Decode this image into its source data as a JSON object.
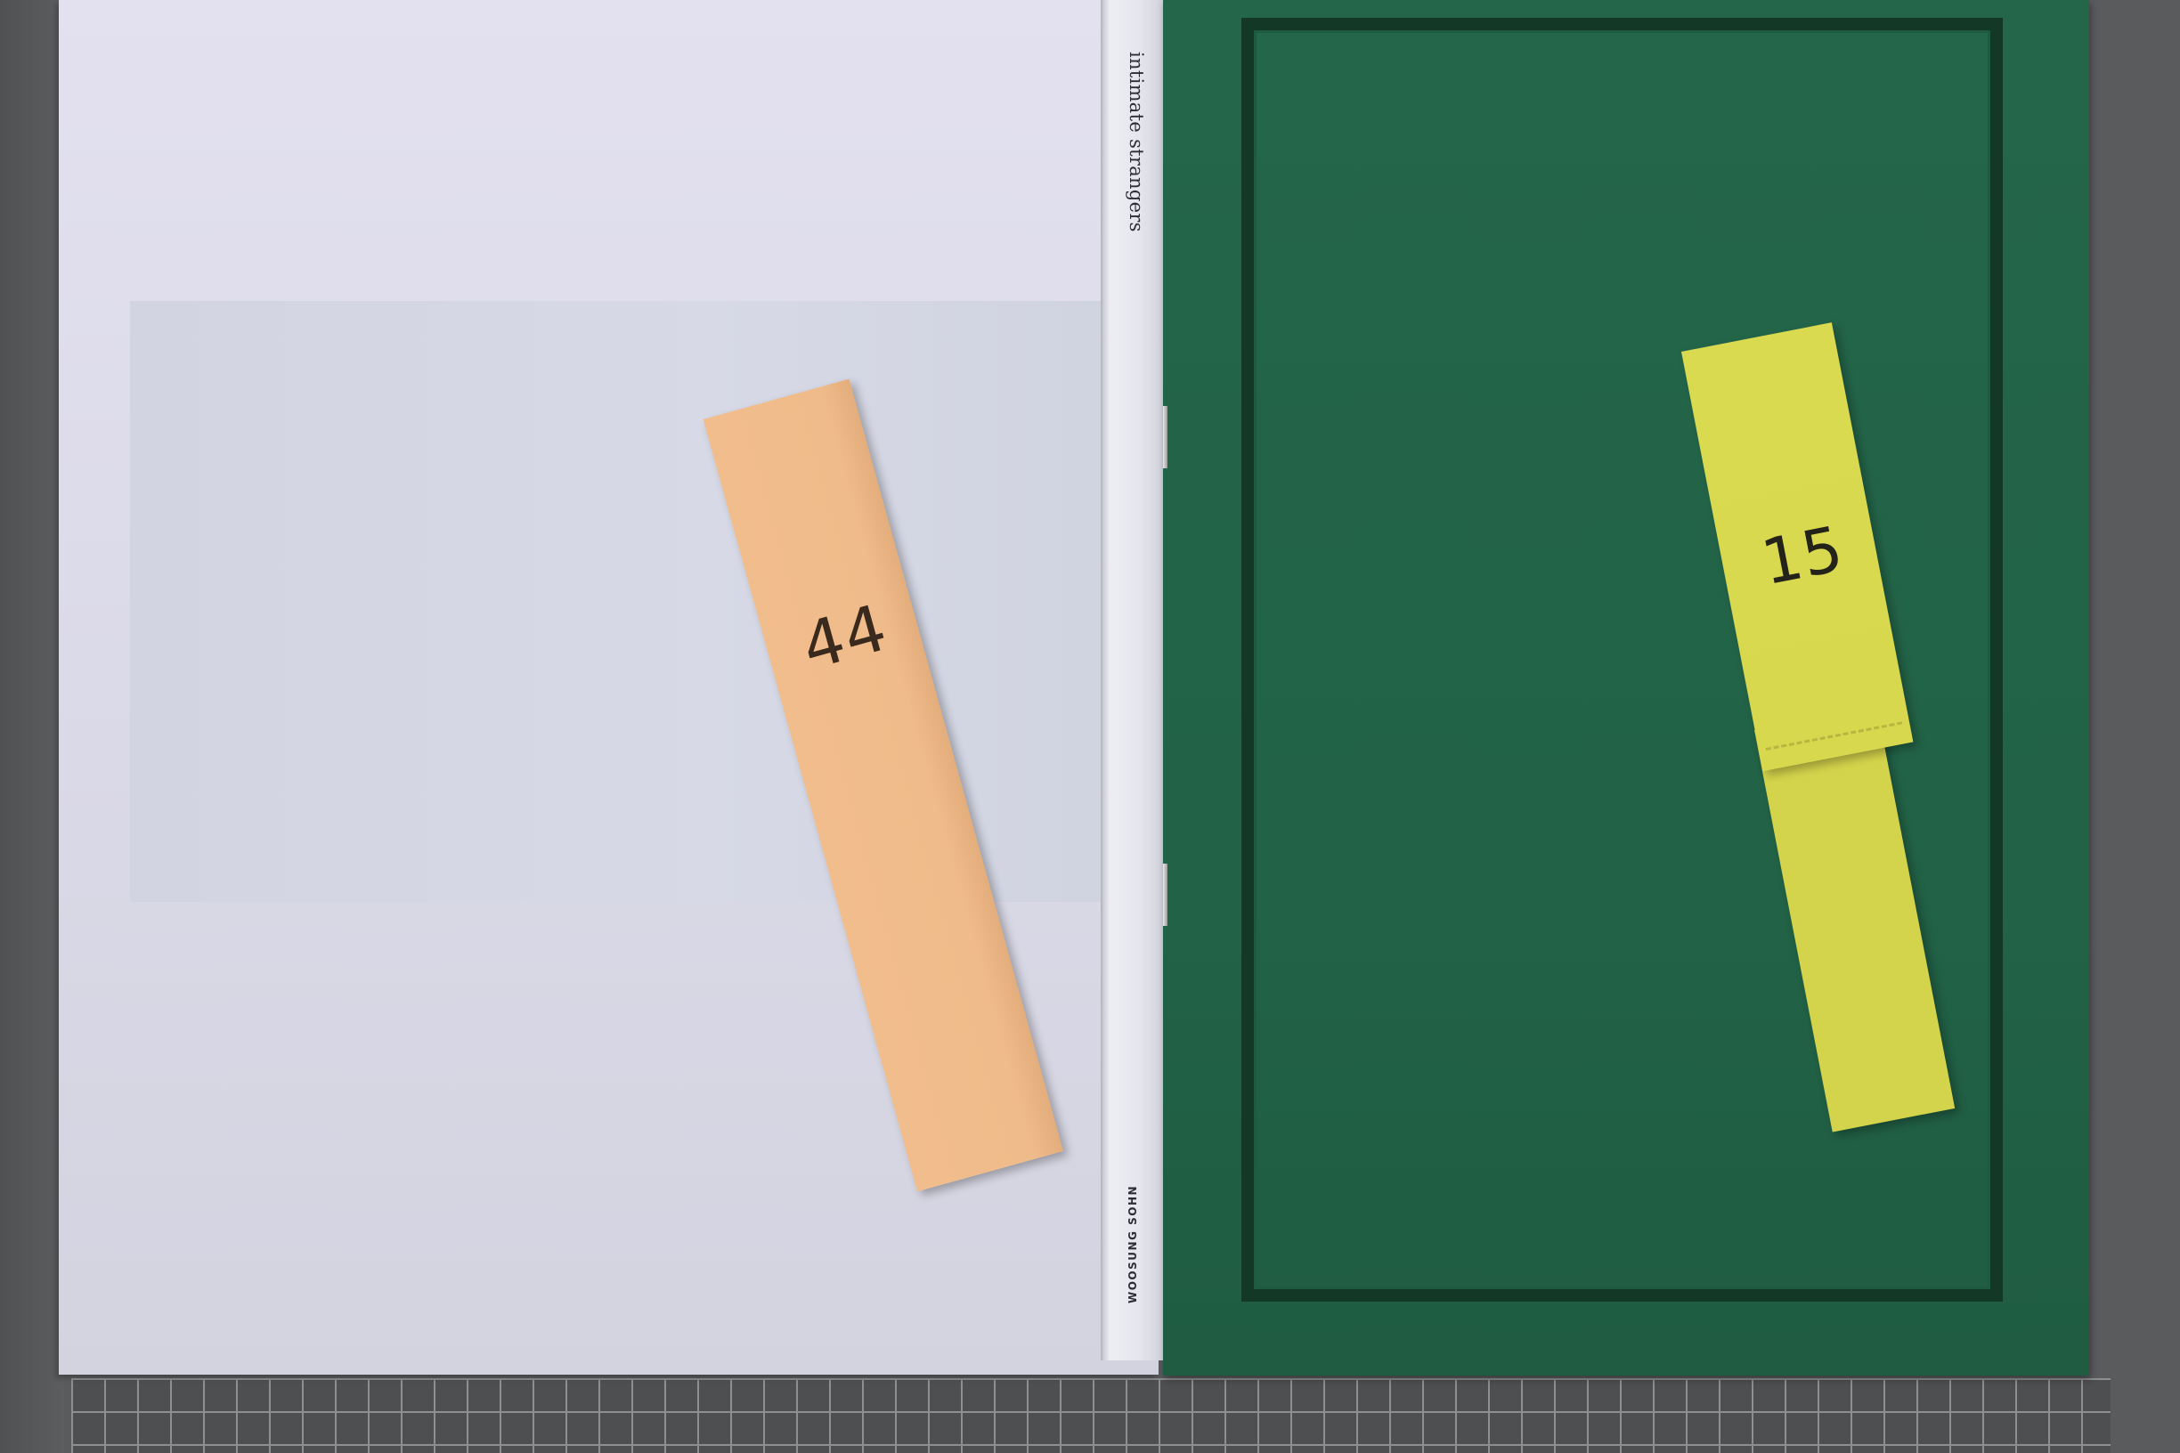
{
  "scene": {
    "colors": {
      "mat": "#5a5b5d",
      "white_cover": "#dedded",
      "green_cover": "#22634a",
      "frame": "#133826",
      "bookmark_orange": "#f0bb8a",
      "bookmark_yellow": "#d8d84e"
    }
  },
  "white_booklet": {
    "spine_title": "intimate strangers",
    "spine_author": "WOOSUNG SOHN"
  },
  "bookmarks": {
    "orange": {
      "number": "44"
    },
    "yellow": {
      "number": "15"
    }
  }
}
